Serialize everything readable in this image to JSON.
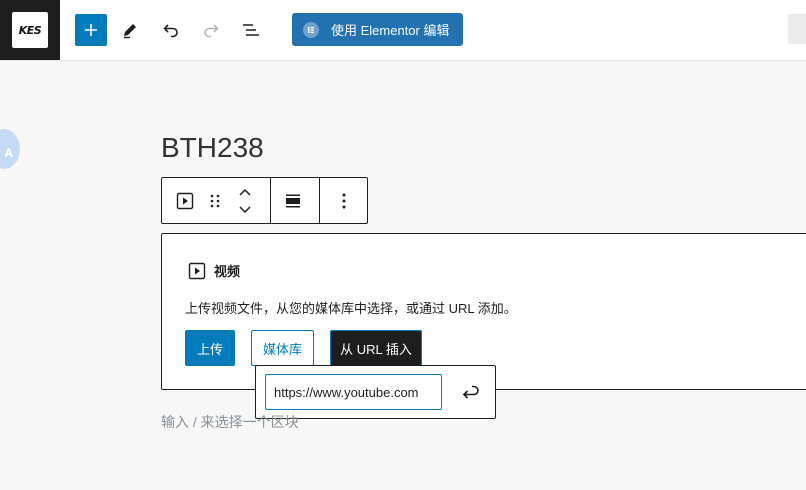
{
  "header": {
    "logo_text": "KES",
    "elementor_button_label": "使用 Elementor 编辑",
    "icons": {
      "add": "plus-icon",
      "edit": "pencil-icon",
      "undo": "undo-icon",
      "redo": "redo-icon",
      "outline": "list-view-icon",
      "elementor": "elementor-icon"
    },
    "accent_color": "#007cba"
  },
  "avatar_initial": "A",
  "post": {
    "title": "BTH238"
  },
  "block_toolbar": {
    "icons": [
      "video-icon",
      "drag-handle-icon",
      "move-up-icon",
      "move-down-icon",
      "align-icon",
      "more-options-icon"
    ]
  },
  "video_block": {
    "title": "视频",
    "instructions": "上传视频文件，从您的媒体库中选择，或通过 URL 添加。",
    "buttons": {
      "upload": "上传",
      "media_library": "媒体库",
      "insert_url": "从 URL 插入"
    }
  },
  "url_popover": {
    "input_value": "https://www.youtube.com",
    "submit_icon": "enter-icon"
  },
  "appender": {
    "placeholder": "输入 / 来选择一个区块"
  }
}
